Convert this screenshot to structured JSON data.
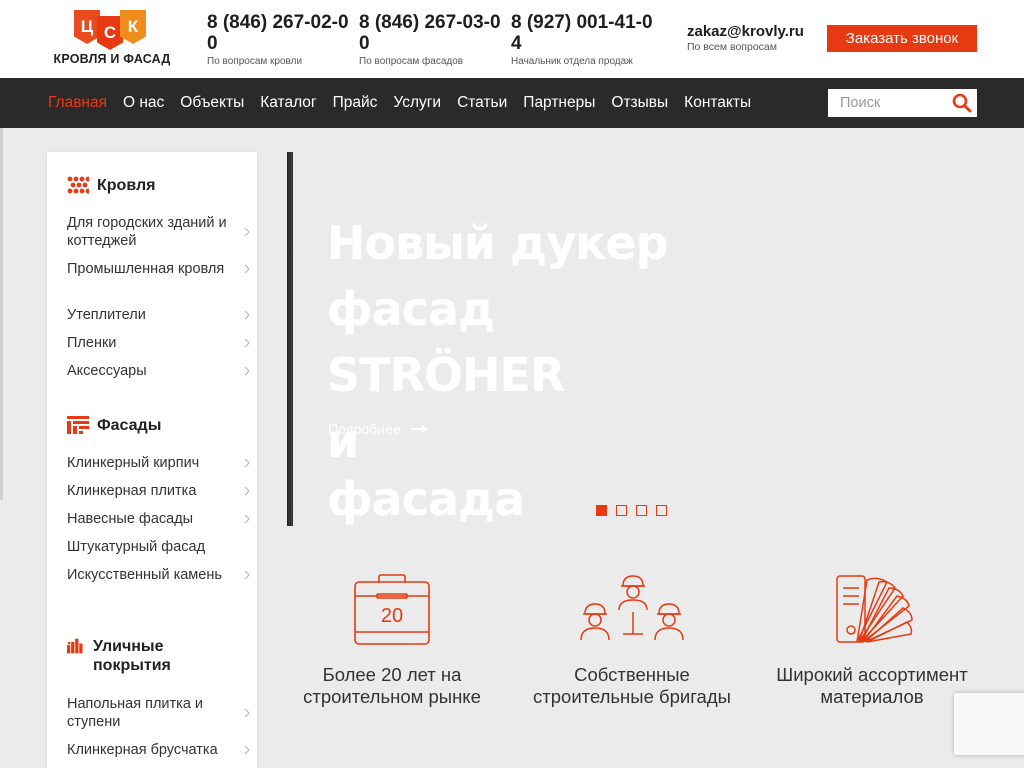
{
  "logo": {
    "letters": [
      "Ц",
      "С",
      "К"
    ],
    "text": "КРОВЛЯ И ФАСАД"
  },
  "phones": [
    {
      "number": "8 (846) 267-02-00",
      "note": "По вопросам кровли"
    },
    {
      "number": "8 (846) 267-03-00",
      "note": "По вопросам фасадов"
    },
    {
      "number": "8 (927) 001-41-04",
      "note": "Начальник отдела продаж"
    }
  ],
  "email": {
    "address": "zakaz@krovly.ru",
    "note": "По всем вопросам"
  },
  "callback_label": "Заказать звонок",
  "nav": {
    "items": [
      "Главная",
      "О нас",
      "Объекты",
      "Каталог",
      "Прайс",
      "Услуги",
      "Статьи",
      "Партнеры",
      "Отзывы",
      "Контакты"
    ],
    "active": "Главная"
  },
  "search": {
    "placeholder": "Поиск"
  },
  "sidebar": {
    "sections": [
      {
        "title": "Кровля",
        "icon": "roof-tiles-icon",
        "items": [
          "Для городских зданий и коттеджей",
          "Промышленная кровля",
          "Утеплители",
          "Пленки",
          "Аксессуары"
        ]
      },
      {
        "title": "Фасады",
        "icon": "facade-icon",
        "items": [
          "Клинкерный кирпич",
          "Клинкерная плитка",
          "Навесные фасады",
          "Штукатурный фасад",
          "Искусственный камень"
        ]
      },
      {
        "title": "Уличные покрытия",
        "icon": "paving-icon",
        "items": [
          "Напольная плитка и ступени",
          "Клинкерная брусчатка"
        ]
      }
    ]
  },
  "hero": {
    "title_lines": [
      "Новый дукер",
      "фасад",
      "STRÖHER",
      "и",
      "фасада"
    ],
    "link_label": "Подробнее",
    "slides": 4,
    "active_slide": 1
  },
  "features": [
    {
      "icon": "briefcase-20-icon",
      "badge": "20",
      "caption": "Более 20 лет на строительном рынке"
    },
    {
      "icon": "workers-team-icon",
      "caption": "Собственные строительные бригады"
    },
    {
      "icon": "swatch-fan-icon",
      "caption": "Широкий ассортимент материалов"
    }
  ],
  "colors": {
    "accent": "#e73a12",
    "nav_bg": "#2b2a2a",
    "page_bg": "#ebebeb"
  }
}
